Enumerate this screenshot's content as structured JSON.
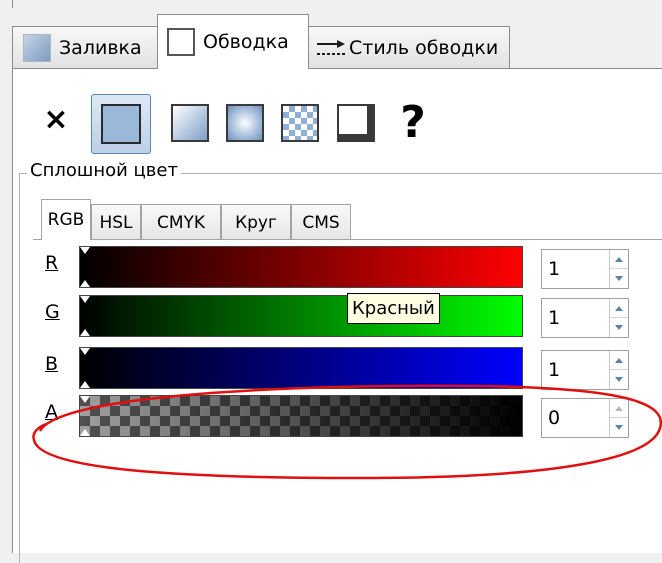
{
  "tabs": [
    {
      "label": "Заливка",
      "active": false
    },
    {
      "label": "Обводка",
      "active": true
    },
    {
      "label": "Стиль обводки",
      "active": false
    }
  ],
  "paint_modes": {
    "none_symbol": "×",
    "unset_symbol": "?",
    "selected": "flat-color"
  },
  "solid_color": {
    "legend": "Сплошной цвет",
    "color_tabs": [
      "RGB",
      "HSL",
      "CMYK",
      "Круг",
      "CMS"
    ],
    "active_tab": "RGB",
    "channels": [
      {
        "label": "R",
        "value": "1"
      },
      {
        "label": "G",
        "value": "1"
      },
      {
        "label": "B",
        "value": "1"
      },
      {
        "label": "A",
        "value": "0"
      }
    ]
  },
  "tooltip": "Красный",
  "colors": {
    "annotation": "#e01010",
    "selection": "#5e86b4"
  }
}
